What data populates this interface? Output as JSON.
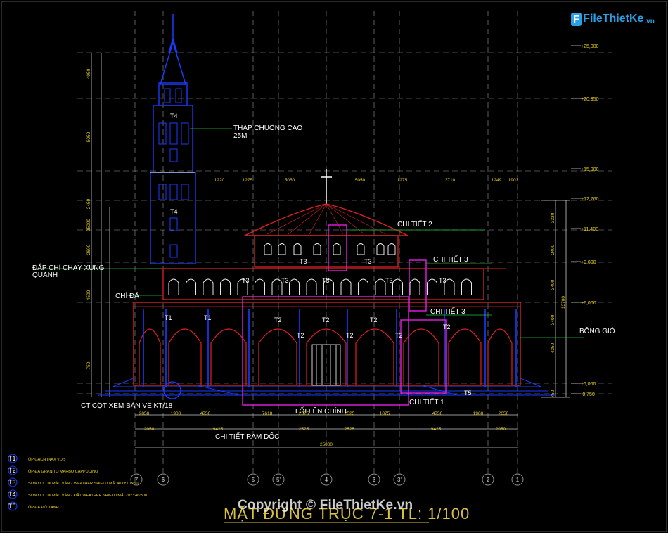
{
  "drawing": {
    "title": "MẶT ĐỨNG TRỤC 7-1 TL: 1/100",
    "colors": {
      "background": "#000000",
      "outline": "#1a3cff",
      "red": "#e02020",
      "magenta": "#e020e0",
      "green": "#20c040",
      "white": "#ffffff",
      "yellow": "#e8d020",
      "title": "#d8c040"
    }
  },
  "watermark": {
    "logo_text": "FileThietKe",
    "logo_suffix": ".vn",
    "copyright": "Copyright © FileThietKe.vn"
  },
  "labels": {
    "tower_label": "THÁP CHUÔNG CAO",
    "tower_height": "25M",
    "detail_2": "CHI TIẾT 2",
    "detail_3a": "CHI TIẾT 3",
    "detail_3b": "CHI TIẾT 3",
    "detail_1": "CHI TIẾT 1",
    "chi_da": "CHỈ ĐÁ",
    "chay_chi_1": "ĐẮP CHỈ CHẠY XUNG",
    "chay_chi_2": "QUANH",
    "bong_gio": "BÔNG GIÓ",
    "ct_cot": "CT CỘT XEM BẢN VẼ KT/18",
    "loi_len": "LỐI LÊN CHÍNH",
    "ram_doc": "CHI TIẾT RAM DỐC"
  },
  "tags": {
    "t1": "T1",
    "t2": "T2",
    "t3": "T3",
    "t4": "T4",
    "t5": "T5"
  },
  "elevations": [
    "+25,000",
    "+20,950",
    "+15,900",
    "+12,760",
    "+11,400",
    "+9,000",
    "+6,000",
    "±0,000",
    "-0,750"
  ],
  "right_dims": [
    "3330",
    "2400",
    "3400",
    "3400",
    "4350",
    "750",
    "13700"
  ],
  "left_dims": [
    "4050",
    "5050",
    "2450",
    "2600",
    "4500",
    "750",
    "25000"
  ],
  "top_dims": [
    "1220",
    "1275",
    "5050",
    "5050",
    "1275",
    "3710",
    "1249",
    "1903"
  ],
  "bottom_dims_1": [
    "2050",
    "1900",
    "4750",
    "7618",
    "2525",
    "2525",
    "1075",
    "4750",
    "1900",
    "2050"
  ],
  "bottom_dims_2": [
    "2050",
    "9425",
    "2525",
    "2525",
    "9425",
    "2050"
  ],
  "bottom_total": "25000",
  "axes": [
    "7",
    "6",
    "5",
    "5'",
    "4",
    "3",
    "3'",
    "2",
    "1"
  ],
  "legend": [
    {
      "tag": "T1",
      "text": "ỐP GẠCH INAX VD 5"
    },
    {
      "tag": "T2",
      "text": "ỐP ĐÁ GRANITO MARBO CAPPUCINO"
    },
    {
      "tag": "T3",
      "text": "SƠN DULUX MÀU VÀNG WEATHER SHIELD MÃ: 40YY70/150"
    },
    {
      "tag": "T4",
      "text": "SƠN DULUX MÀU VÀNG ĐẤT WEATHER SHIELD MÃ: 20YY46/300"
    },
    {
      "tag": "T5",
      "text": "ỐP ĐÁ ĐỎ XANH"
    }
  ]
}
